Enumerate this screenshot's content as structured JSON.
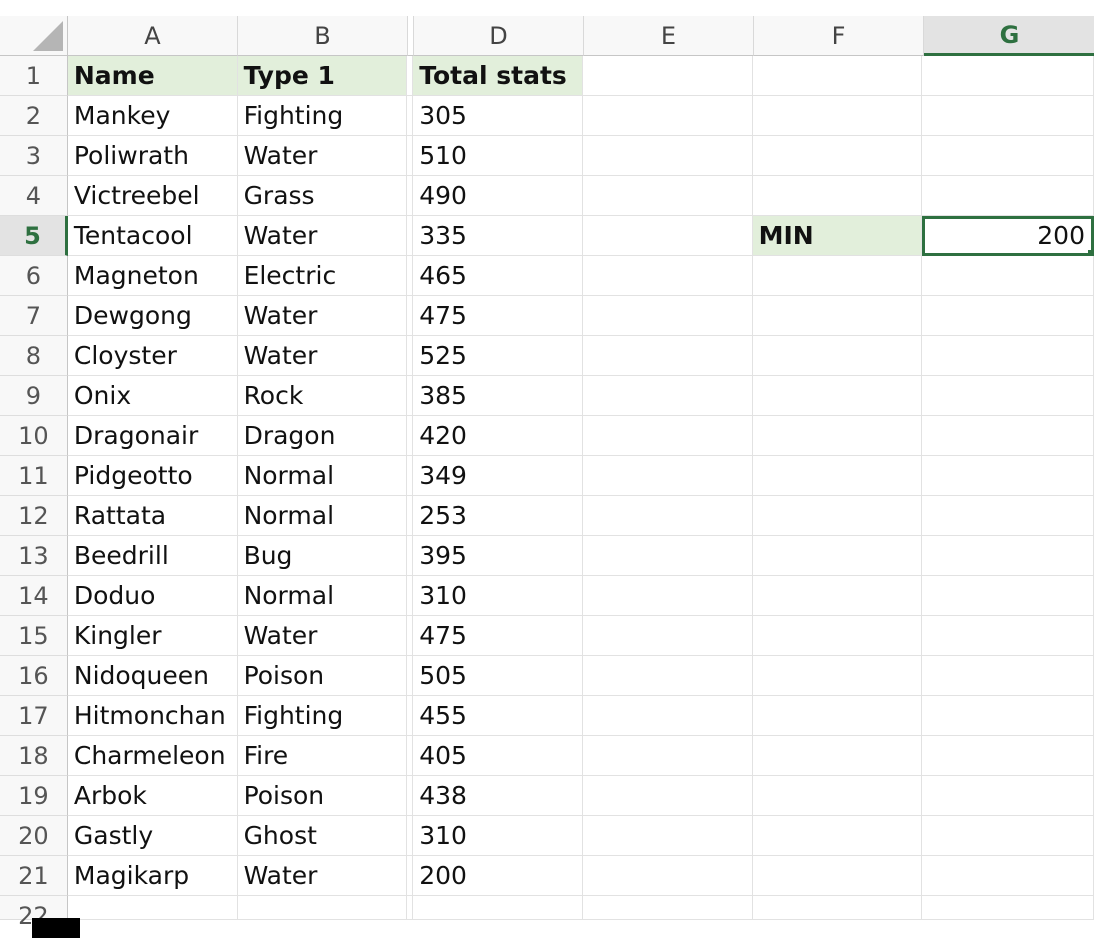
{
  "columns": [
    "A",
    "B",
    "D",
    "E",
    "F",
    "G"
  ],
  "rows": [
    {
      "n": "1",
      "a": "Name",
      "b": "Type 1",
      "d": "Total stats"
    },
    {
      "n": "2",
      "a": "Mankey",
      "b": "Fighting",
      "d": "305"
    },
    {
      "n": "3",
      "a": "Poliwrath",
      "b": "Water",
      "d": "510"
    },
    {
      "n": "4",
      "a": "Victreebel",
      "b": "Grass",
      "d": "490"
    },
    {
      "n": "5",
      "a": "Tentacool",
      "b": "Water",
      "d": "335",
      "f": "MIN",
      "g": "200"
    },
    {
      "n": "6",
      "a": "Magneton",
      "b": "Electric",
      "d": "465"
    },
    {
      "n": "7",
      "a": "Dewgong",
      "b": "Water",
      "d": "475"
    },
    {
      "n": "8",
      "a": "Cloyster",
      "b": "Water",
      "d": "525"
    },
    {
      "n": "9",
      "a": "Onix",
      "b": "Rock",
      "d": "385"
    },
    {
      "n": "10",
      "a": "Dragonair",
      "b": "Dragon",
      "d": "420"
    },
    {
      "n": "11",
      "a": "Pidgeotto",
      "b": "Normal",
      "d": "349"
    },
    {
      "n": "12",
      "a": "Rattata",
      "b": "Normal",
      "d": "253"
    },
    {
      "n": "13",
      "a": "Beedrill",
      "b": "Bug",
      "d": "395"
    },
    {
      "n": "14",
      "a": "Doduo",
      "b": "Normal",
      "d": "310"
    },
    {
      "n": "15",
      "a": "Kingler",
      "b": "Water",
      "d": "475"
    },
    {
      "n": "16",
      "a": "Nidoqueen",
      "b": "Poison",
      "d": "505"
    },
    {
      "n": "17",
      "a": "Hitmonchan",
      "b": "Fighting",
      "d": "455"
    },
    {
      "n": "18",
      "a": "Charmeleon",
      "b": "Fire",
      "d": "405"
    },
    {
      "n": "19",
      "a": "Arbok",
      "b": "Poison",
      "d": "438"
    },
    {
      "n": "20",
      "a": "Gastly",
      "b": "Ghost",
      "d": "310"
    },
    {
      "n": "21",
      "a": "Magikarp",
      "b": "Water",
      "d": "200"
    },
    {
      "n": "22"
    }
  ],
  "selection": {
    "column": "G",
    "row": "5"
  },
  "colors": {
    "accent": "#2e7040",
    "header_fill": "#e2efdb"
  }
}
